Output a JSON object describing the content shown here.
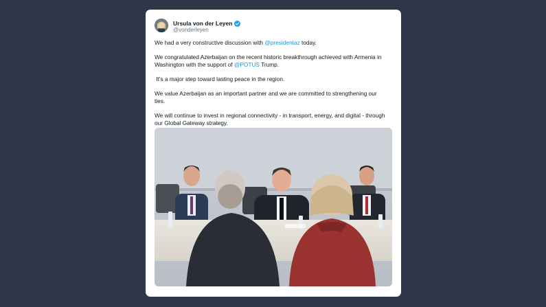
{
  "tweet": {
    "author_name": "Ursula von der Leyen",
    "handle": "@vonderleyen",
    "p1_pre": "We had a very constructive discussion with ",
    "p1_mention": "@presidentaz",
    "p1_post": " today.",
    "p2_line1": "We congratulated Azerbaijan on the recent historic breakthrough achieved with Armenia in",
    "p2_pre": "Washington with the support of ",
    "p2_mention": "@POTUS",
    "p2_post": " Trump.",
    "p3": " It's a major step toward lasting peace in the region.",
    "p4_line1": "We value Azerbaijan as an important partner and we are committed to strengthening our",
    "p4_line2": "ties.",
    "p5_line1": "We will continue to invest in regional connectivity - in transport, energy, and digital - through",
    "p5_line2": "our Global Gateway strategy."
  },
  "icons": {
    "verified": "verified-badge-icon"
  },
  "colors": {
    "background": "#2d3748",
    "mention": "#1b95e0",
    "verified": "#1da1f2"
  }
}
